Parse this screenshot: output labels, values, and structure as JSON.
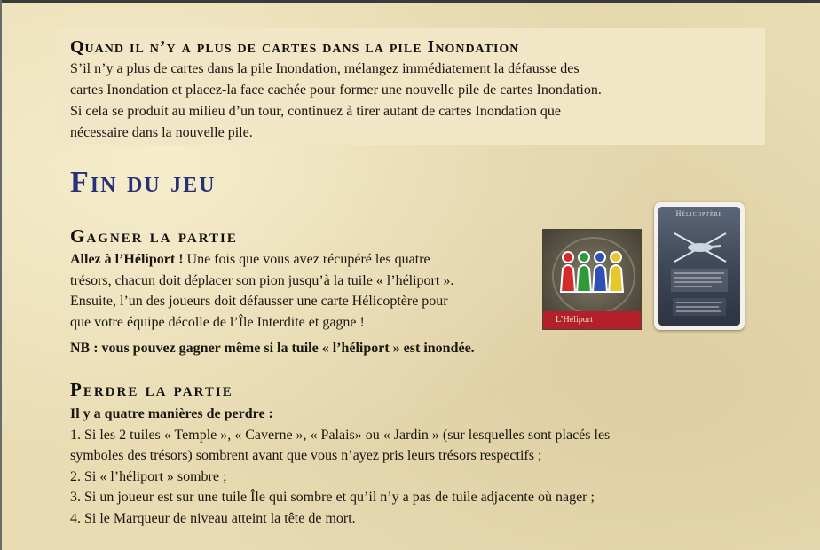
{
  "empty_pile": {
    "title": "Quand il n’y a plus de cartes dans la pile Inondation",
    "lines": [
      "S’il n’y a plus de cartes dans la pile Inondation, mélangez immédiatement la défausse des",
      "cartes Inondation et placez-la face cachée pour former une nouvelle pile de cartes Inondation.",
      "Si cela se produit au milieu d’un tour, continuez à tirer autant de cartes Inondation que",
      "nécessaire dans la nouvelle pile."
    ]
  },
  "end": {
    "title": "Fin du jeu"
  },
  "win": {
    "title": "Gagner la partie",
    "lead": "Allez à l’Héliport !",
    "line1": " Une fois que vous avez récupéré les quatre",
    "lines": [
      "trésors, chacun doit déplacer son pion jusqu’à la tuile « l’héliport ».",
      "Ensuite, l’un des joueurs doit défausser une carte Hélicoptère pour",
      "que votre équipe décolle de l’Île Interdite et gagne !"
    ],
    "nb": "NB : vous pouvez gagner même si la tuile « l’héliport » est inondée.",
    "tile_label": "L’Héliport",
    "card_label": "Hélicoptère",
    "pawn_colors": [
      "#d42a2a",
      "#2e9a3a",
      "#2f4fb6",
      "#e6c828"
    ]
  },
  "lose": {
    "title": "Perdre la partie",
    "intro": "Il y a quatre manières de perdre :",
    "items": [
      "1. Si les 2 tuiles « Temple », « Caverne », « Palais» ou « Jardin » (sur lesquelles sont placés les",
      "symboles des trésors) sombrent avant que vous n’ayez pris leurs trésors respectifs ;",
      "2. Si « l’héliport » sombre ;",
      "3. Si un joueur est sur une tuile Île qui sombre et qu’il n’y a pas de tuile adjacente où nager ;",
      "4. Si le Marqueur de niveau atteint la tête de mort."
    ]
  }
}
